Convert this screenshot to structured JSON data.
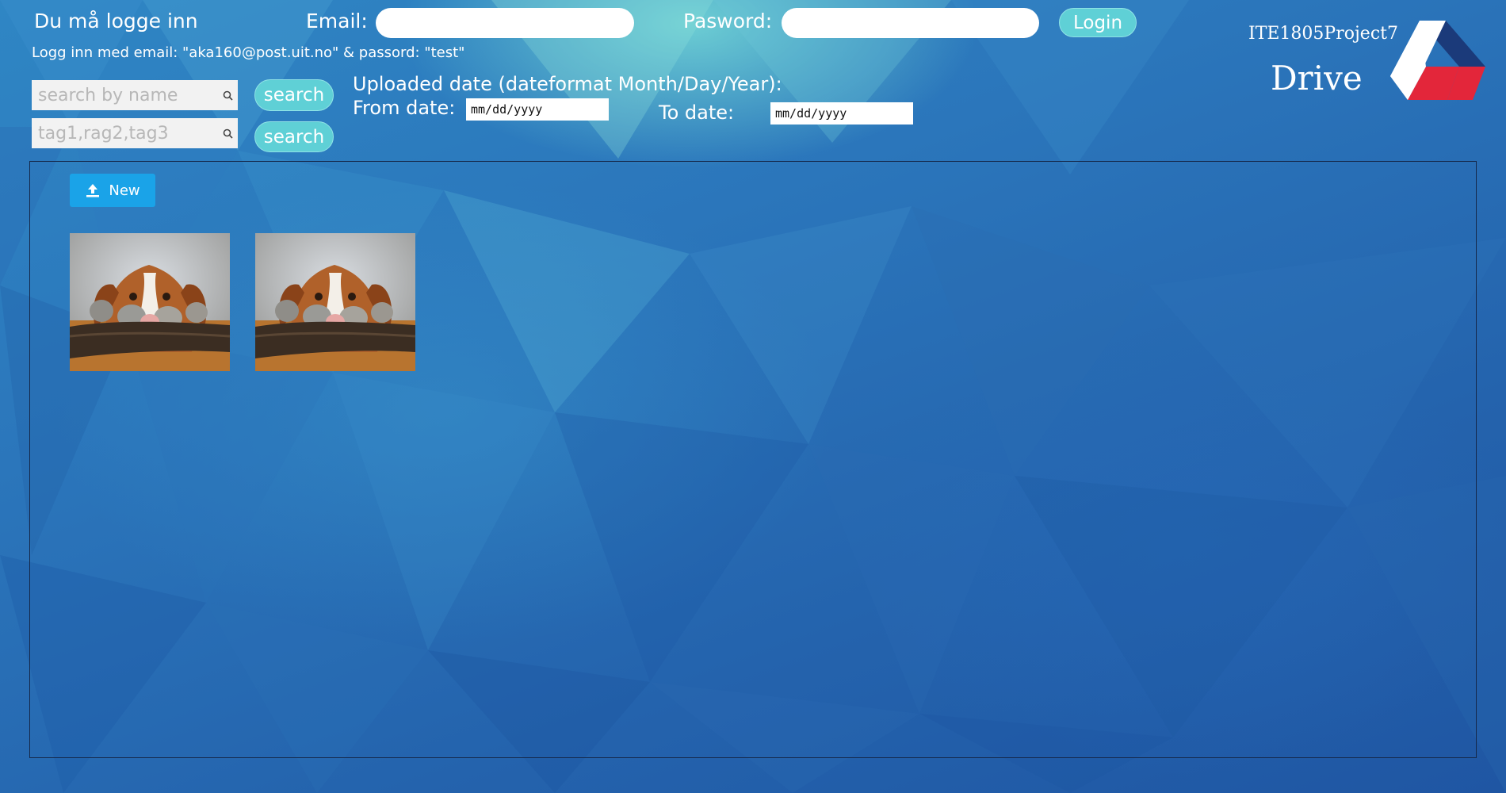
{
  "header": {
    "login_prompt": "Du må logge inn",
    "email_label": "Email:",
    "password_label": "Pasword:",
    "login_button": "Login",
    "credentials_hint": "Logg inn med email: \"aka160@post.uit.no\"  & passord: \"test\""
  },
  "search": {
    "name_placeholder": "search by name",
    "tags_placeholder": "tag1,rag2,tag3",
    "name_button": "search",
    "tags_button": "search"
  },
  "date_filter": {
    "heading": "Uploaded date (dateformat Month/Day/Year):",
    "from_label": "From date:",
    "to_label": "To date:",
    "from_value": "mm/dd/yyyy",
    "to_value": "mm/dd/yyyy"
  },
  "brand": {
    "project": "ITE1805Project7",
    "product": "Drive",
    "logo_colors": [
      "#1b3a7a",
      "#e3263a",
      "#ffffff"
    ]
  },
  "files": {
    "new_button": "New",
    "new_icon": "upload-icon",
    "items": [
      {
        "kind": "image",
        "subject": "dog-with-kittens"
      },
      {
        "kind": "image",
        "subject": "dog-with-kittens"
      }
    ]
  },
  "colors": {
    "accent_teal": "#5fd0d6",
    "primary_blue": "#1aa3e8"
  }
}
